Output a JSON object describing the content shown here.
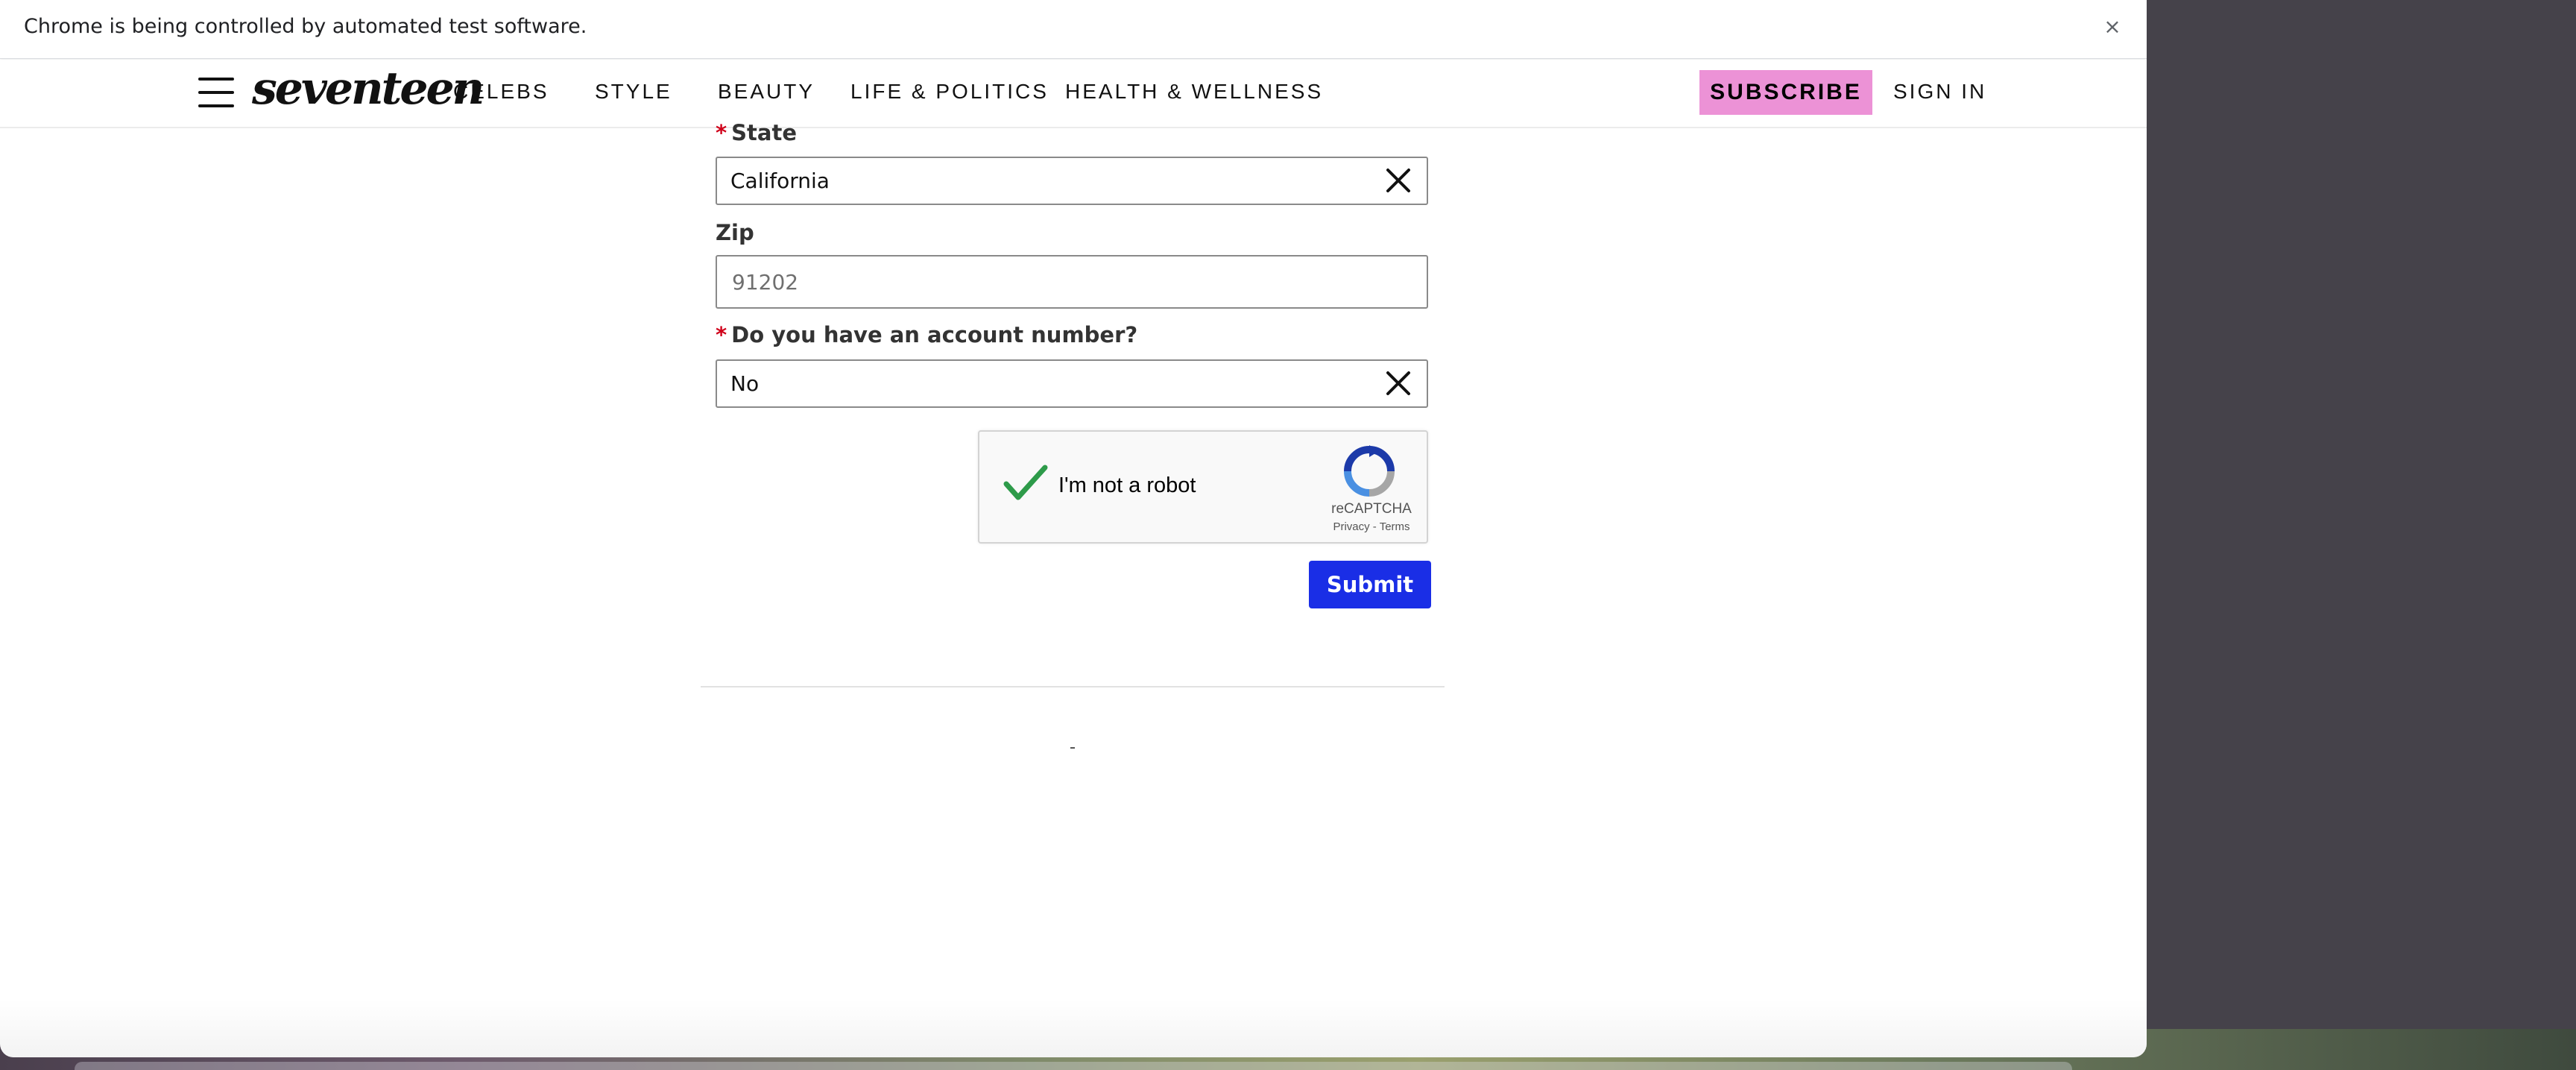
{
  "infobar": {
    "message": "Chrome is being controlled by automated test software.",
    "close_glyph": "×"
  },
  "site": {
    "logo": "seventeen",
    "nav": [
      "CELEBS",
      "STYLE",
      "BEAUTY",
      "LIFE & POLITICS",
      "HEALTH & WELLNESS"
    ],
    "subscribe_label": "SUBSCRIBE",
    "signin_label": "SIGN IN",
    "subscribe_color": "#ec92d6"
  },
  "form": {
    "state": {
      "required_mark": "*",
      "label": "State",
      "value": "California",
      "clear_icon": "close-icon"
    },
    "zip": {
      "label": "Zip",
      "placeholder": "91202"
    },
    "account": {
      "required_mark": "*",
      "label": "Do you have an account number?",
      "value": "No",
      "clear_icon": "close-icon"
    },
    "recaptcha": {
      "label": "I'm not a robot",
      "checked": true,
      "brand": "reCAPTCHA",
      "privacy": "Privacy",
      "separator": "-",
      "terms": "Terms"
    },
    "submit_label": "Submit",
    "submit_color": "#1a2ee6"
  }
}
